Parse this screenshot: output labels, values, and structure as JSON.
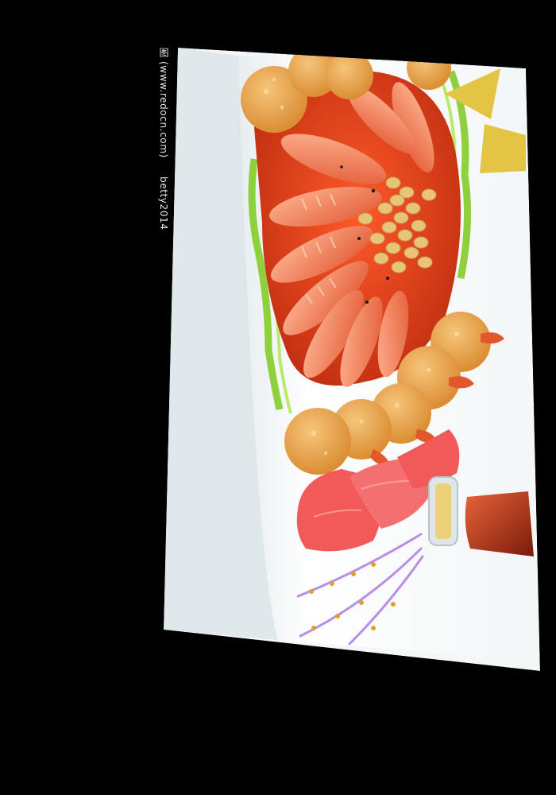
{
  "photo": {
    "subject": "shrimp-platter",
    "watermark": {
      "glyph": "图",
      "url_text": "(www.redocn.com)",
      "author": "betty2014"
    },
    "colors": {
      "background": "#000000",
      "plate": "#f7f9fa",
      "plate_shadow": "#c9d3d8",
      "sauce": "#d8401a",
      "shrimp": "#f07a4e",
      "fried_shrimp": "#e9a24a",
      "pepper_ring": "#8fd13c",
      "soy_bean": "#e8c47a",
      "salmon_slice": "#f25a5a",
      "corner_accent": "#e4c445",
      "drizzle": "#b88ee8",
      "sauce_bottle": "#a8301a"
    }
  }
}
